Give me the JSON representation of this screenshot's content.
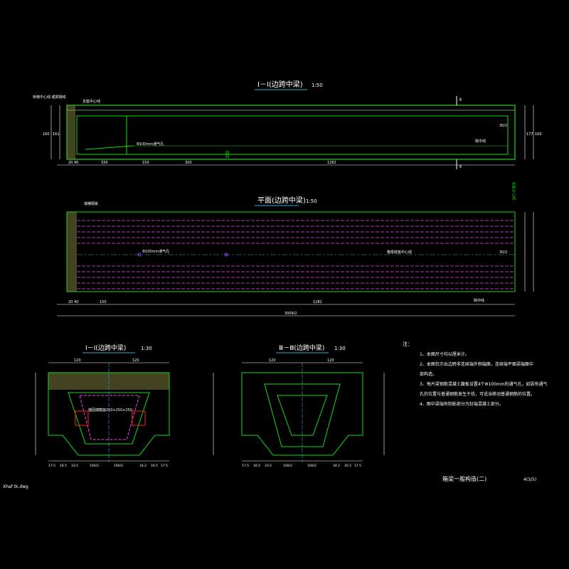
{
  "section_I": {
    "title": "Ⅰ－Ⅰ(边跨中梁)",
    "scale": "1:50"
  },
  "plan": {
    "title": "平面(边跨中梁)",
    "scale": "1:50"
  },
  "section_II": {
    "title": "Ⅰ－Ⅰ(边跨中梁)",
    "scale": "1:30"
  },
  "section_III": {
    "title": "Ⅲ－Ⅲ(边跨中梁)",
    "scale": "1:30"
  },
  "labels": {
    "support_center": "支座中心线",
    "bridge_center": "桥墩中心线\n或梁端线",
    "vent_hole": "Φ100mm通气孔",
    "span_center": "跨中线",
    "end_diaphragm": "端横隔板",
    "cross_section_II": "Ⅱ",
    "cross_section_III": "Ⅲ",
    "ratio": "30/2",
    "plan_centerline": "箱梁底板中心线",
    "vertical_note": "桥跨中心线",
    "box_dim": "锚固端截面250×250×250"
  },
  "dims_top": [
    "20",
    "40",
    "330",
    "150",
    "300",
    "1282"
  ],
  "dims_plan": [
    "20",
    "40",
    "150",
    "1282",
    "3009/2"
  ],
  "dims_sec2": [
    "17.5",
    "16.5",
    "33.5",
    "100/2",
    "100/2",
    "34.2",
    "16.5",
    "17.5"
  ],
  "notes": {
    "heading": "注：",
    "items": [
      "1、本图尺寸均以厘米计。",
      "2、本图仅示出边跨非连续端外侧端面，连续端平面梁端面中",
      "   部构造。",
      "3、每片梁钢筋混凝土腹板设置4个Φ100mm的通气孔，如因有通气",
      "   孔的位置与普通钢筋发生干扰，可适当移动普通钢筋的位置。",
      "4、图中梁端有阴影部分为封端混凝土部分。"
    ]
  },
  "title_block": {
    "name": "箱梁一般构造(二)",
    "page": "4(3/5)"
  },
  "file_name": "Xhaf tk.dwg"
}
